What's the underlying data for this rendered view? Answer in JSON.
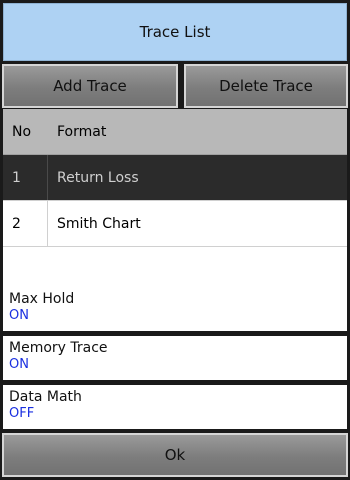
{
  "title": "Trace List",
  "buttons": {
    "add": "Add Trace",
    "delete": "Delete Trace",
    "ok": "Ok"
  },
  "table": {
    "headers": {
      "no": "No",
      "format": "Format"
    },
    "rows": [
      {
        "no": "1",
        "format": "Return Loss",
        "selected": true
      },
      {
        "no": "2",
        "format": "Smith Chart",
        "selected": false
      }
    ]
  },
  "settings": [
    {
      "label": "Max Hold",
      "value": "ON"
    },
    {
      "label": "Memory Trace",
      "value": "ON"
    },
    {
      "label": "Data Math",
      "value": "OFF"
    }
  ],
  "colors": {
    "title_bg": "#aed2f3",
    "selected_row_bg": "#2b2b2b",
    "value_text": "#1a2fe0"
  }
}
